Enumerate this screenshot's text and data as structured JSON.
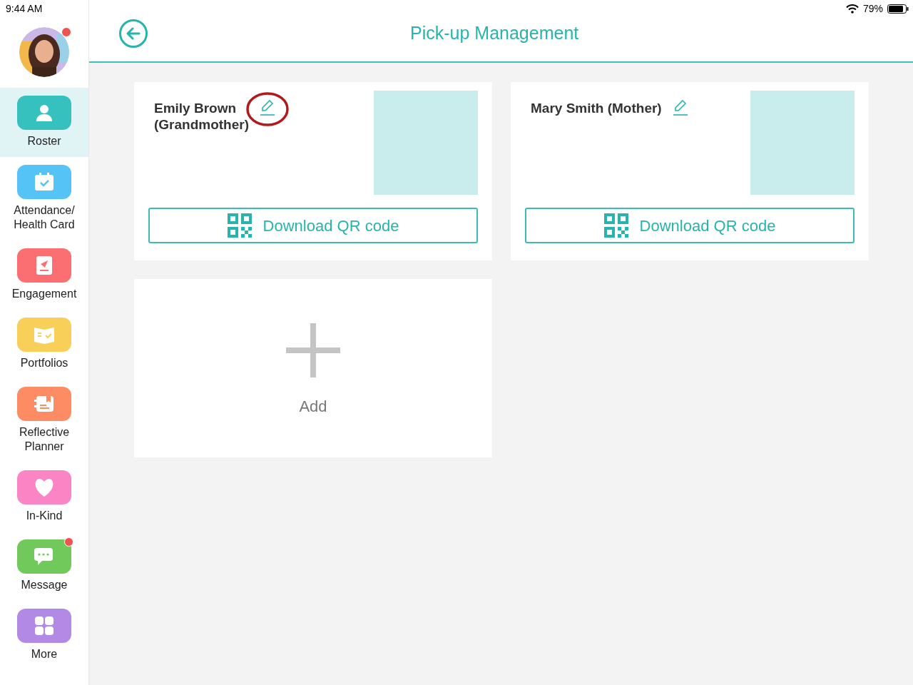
{
  "status_bar": {
    "time": "9:44 AM",
    "battery": "79%"
  },
  "profile": {
    "badge": true
  },
  "sidebar": {
    "items": [
      {
        "label": "Roster",
        "kind": "person",
        "color": "#36c1bf",
        "selected": true,
        "badge": false
      },
      {
        "label": "Attendance/\nHealth Card",
        "kind": "calendar",
        "color": "#55c3f5",
        "selected": false,
        "badge": false
      },
      {
        "label": "Engagement",
        "kind": "note",
        "color": "#fb6e72",
        "selected": false,
        "badge": false
      },
      {
        "label": "Portfolios",
        "kind": "book",
        "color": "#f8cf58",
        "selected": false,
        "badge": false
      },
      {
        "label": "Reflective\nPlanner",
        "kind": "planner",
        "color": "#fd8b64",
        "selected": false,
        "badge": false
      },
      {
        "label": "In-Kind",
        "kind": "heart",
        "color": "#fb84c4",
        "selected": false,
        "badge": false
      },
      {
        "label": "Message",
        "kind": "chat",
        "color": "#71c95c",
        "selected": false,
        "badge": true
      },
      {
        "label": "More",
        "kind": "grid",
        "color": "#b28ae6",
        "selected": false,
        "badge": false
      }
    ]
  },
  "header": {
    "title": "Pick-up Management"
  },
  "pickup_people": [
    {
      "name": "Emily Brown\n(Grandmother)",
      "circled": true,
      "button": "Download QR code"
    },
    {
      "name": "Mary Smith (Mother)",
      "circled": false,
      "button": "Download QR code"
    }
  ],
  "add_card": {
    "label": "Add"
  }
}
